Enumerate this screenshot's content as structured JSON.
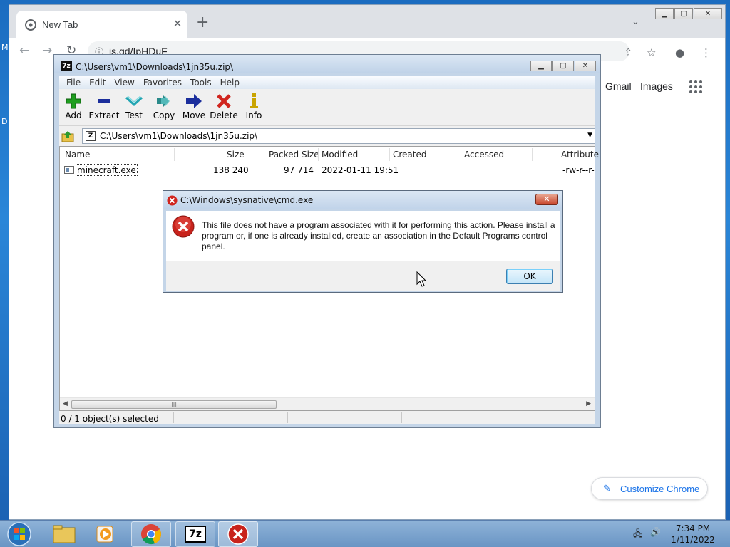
{
  "desktop": {
    "clip_text_1": "M",
    "clip_text_2": "D"
  },
  "chrome": {
    "tab_title": "New Tab",
    "tab_close": "✕",
    "new_tab": "+",
    "url": "is.gd/IpHDuF",
    "gmail": "Gmail",
    "images": "Images",
    "customize": "Customize Chrome"
  },
  "sevenzip": {
    "title": "C:\\Users\\vm1\\Downloads\\1jn35u.zip\\",
    "app_icon": "7z",
    "menu": [
      "File",
      "Edit",
      "View",
      "Favorites",
      "Tools",
      "Help"
    ],
    "toolbar": [
      {
        "label": "Add",
        "icon": "plus-icon",
        "color": "#1f9e1f"
      },
      {
        "label": "Extract",
        "icon": "minus-icon",
        "color": "#1b2e9c"
      },
      {
        "label": "Test",
        "icon": "check-chevron-icon",
        "color": "#22a6b3"
      },
      {
        "label": "Copy",
        "icon": "double-arrow-icon",
        "color": "#2a8a8a"
      },
      {
        "label": "Move",
        "icon": "arrow-right-icon",
        "color": "#1b2e9c"
      },
      {
        "label": "Delete",
        "icon": "x-icon",
        "color": "#d0251e"
      },
      {
        "label": "Info",
        "icon": "info-icon",
        "color": "#c9a400"
      }
    ],
    "address": "C:\\Users\\vm1\\Downloads\\1jn35u.zip\\",
    "columns": [
      "Name",
      "Size",
      "Packed Size",
      "Modified",
      "Created",
      "Accessed",
      "Attribute"
    ],
    "rows": [
      {
        "name": "minecraft.exe",
        "size": "138 240",
        "packed": "97 714",
        "modified": "2022-01-11 19:51",
        "created": "",
        "accessed": "",
        "attr": "-rw-r--r-"
      }
    ],
    "status": "0 / 1 object(s) selected"
  },
  "dialog": {
    "title": "C:\\Windows\\sysnative\\cmd.exe",
    "message": "This file does not have a program associated with it for performing this action. Please install a program or, if one is already installed, create an association in the Default Programs control panel.",
    "ok": "OK",
    "close": "✕"
  },
  "taskbar": {
    "time": "7:34 PM",
    "date": "1/11/2022",
    "sevenzip_label": "7z"
  }
}
